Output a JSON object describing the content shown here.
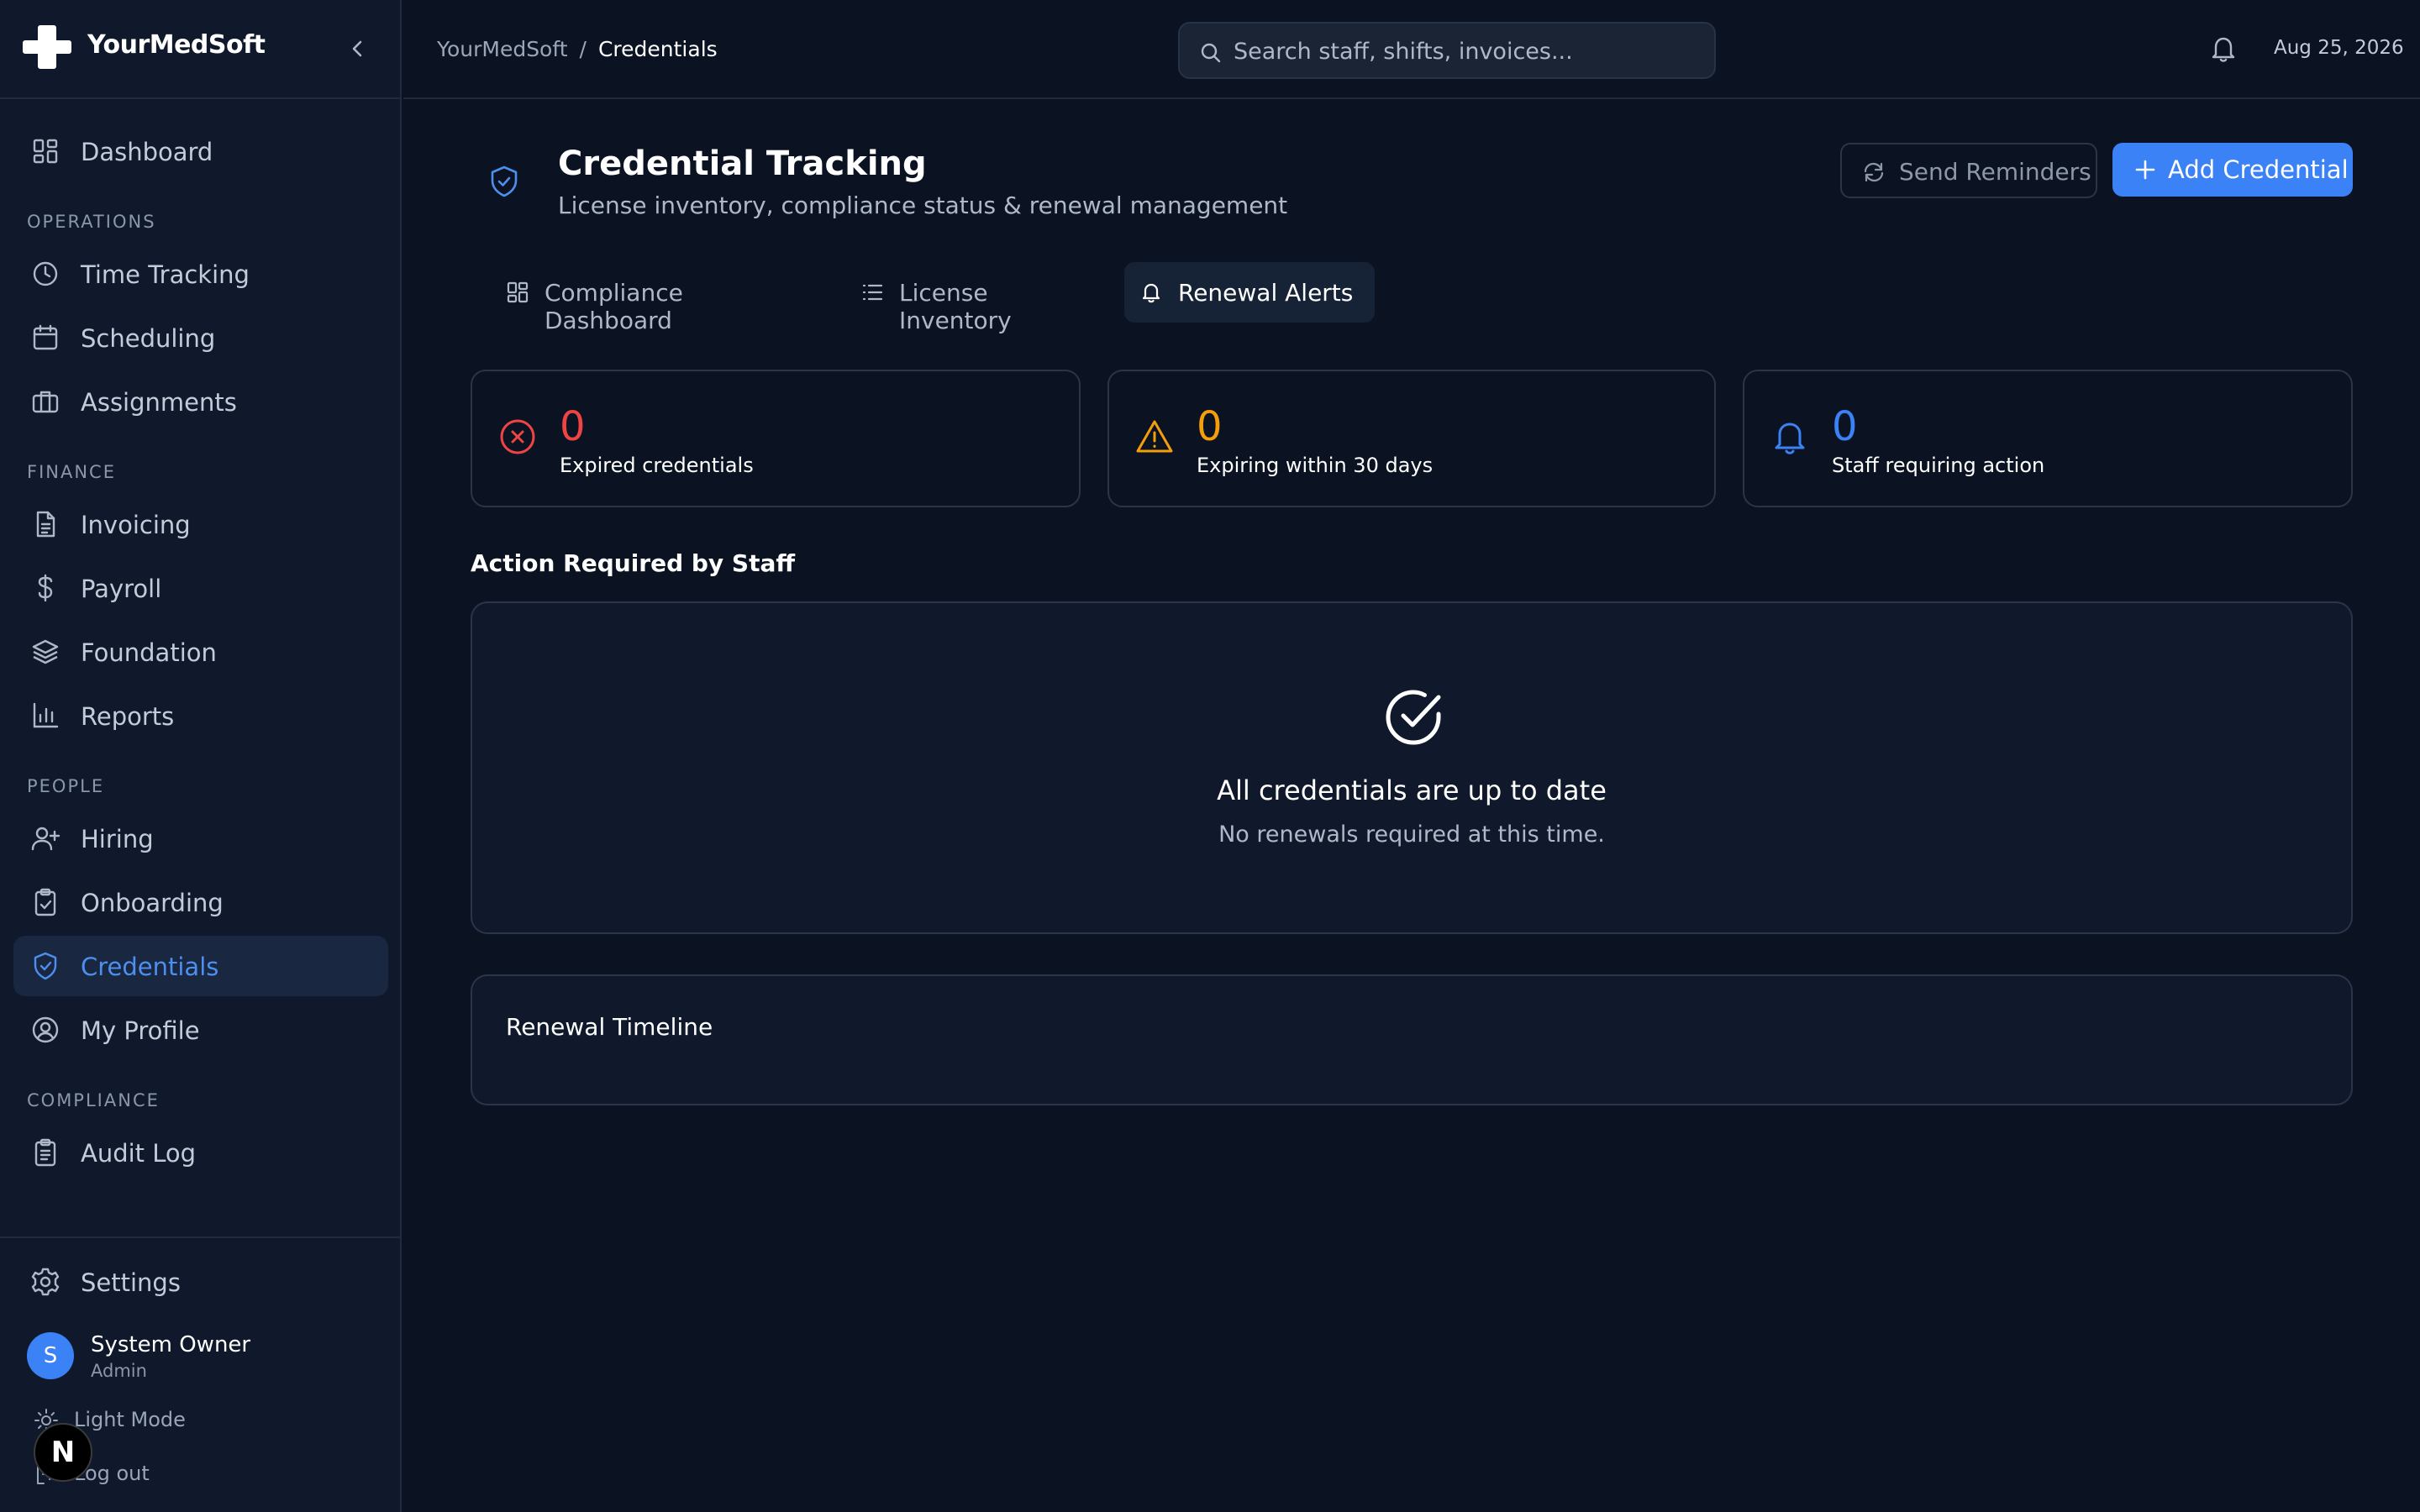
{
  "app": {
    "name": "YourMedSoft"
  },
  "sidebar": {
    "top_item": {
      "label": "Dashboard",
      "icon": "dashboard-icon"
    },
    "sections": {
      "operations": "OPERATIONS",
      "finance": "FINANCE",
      "people": "PEOPLE",
      "compliance": "COMPLIANCE"
    },
    "items": {
      "time_tracking": {
        "label": "Time Tracking",
        "icon": "clock-icon"
      },
      "scheduling": {
        "label": "Scheduling",
        "icon": "calendar-icon"
      },
      "assignments": {
        "label": "Assignments",
        "icon": "briefcase-icon"
      },
      "invoicing": {
        "label": "Invoicing",
        "icon": "document-icon"
      },
      "payroll": {
        "label": "Payroll",
        "icon": "dollar-icon"
      },
      "foundation": {
        "label": "Foundation",
        "icon": "layers-icon"
      },
      "reports": {
        "label": "Reports",
        "icon": "bar-chart-icon"
      },
      "hiring": {
        "label": "Hiring",
        "icon": "user-plus-icon"
      },
      "onboarding": {
        "label": "Onboarding",
        "icon": "clipboard-check-icon"
      },
      "credentials": {
        "label": "Credentials",
        "icon": "shield-check-icon",
        "active": true
      },
      "my_profile": {
        "label": "My Profile",
        "icon": "user-circle-icon"
      },
      "audit_log": {
        "label": "Audit Log",
        "icon": "clipboard-list-icon"
      }
    },
    "settings": {
      "label": "Settings",
      "icon": "gear-icon"
    },
    "user": {
      "initial": "S",
      "name": "System Owner",
      "role": "Admin"
    },
    "light_mode": {
      "label": "Light Mode",
      "icon": "sun-icon"
    },
    "logout": {
      "label": "Log out",
      "icon": "logout-icon"
    },
    "dev_badge": "N"
  },
  "topbar": {
    "breadcrumb": {
      "root": "YourMedSoft",
      "separator": "/",
      "current": "Credentials"
    },
    "search": {
      "placeholder": "Search staff, shifts, invoices...",
      "value": ""
    },
    "date": "Aug 25, 2026"
  },
  "page": {
    "title": "Credential Tracking",
    "subtitle": "License inventory, compliance status & renewal management",
    "actions": {
      "send_reminders": "Send Reminders",
      "add_credential": "Add Credential"
    },
    "tabs": {
      "compliance_dashboard": "Compliance Dashboard",
      "license_inventory": "License Inventory",
      "renewal_alerts": "Renewal Alerts"
    },
    "stats": {
      "expired": {
        "value": "0",
        "label": "Expired credentials",
        "color": "#ef4444"
      },
      "expiring": {
        "value": "0",
        "label": "Expiring within 30 days",
        "color": "#f59e0b"
      },
      "staff_action": {
        "value": "0",
        "label": "Staff requiring action",
        "color": "#3b82f6"
      }
    },
    "action_section_title": "Action Required by Staff",
    "empty_state": {
      "title": "All credentials are up to date",
      "subtitle": "No renewals required at this time."
    },
    "timeline_title": "Renewal Timeline"
  },
  "colors": {
    "accent": "#3b82f6",
    "background": "#0b1322",
    "sidebar": "#0f192b",
    "border": "#2a3548"
  }
}
